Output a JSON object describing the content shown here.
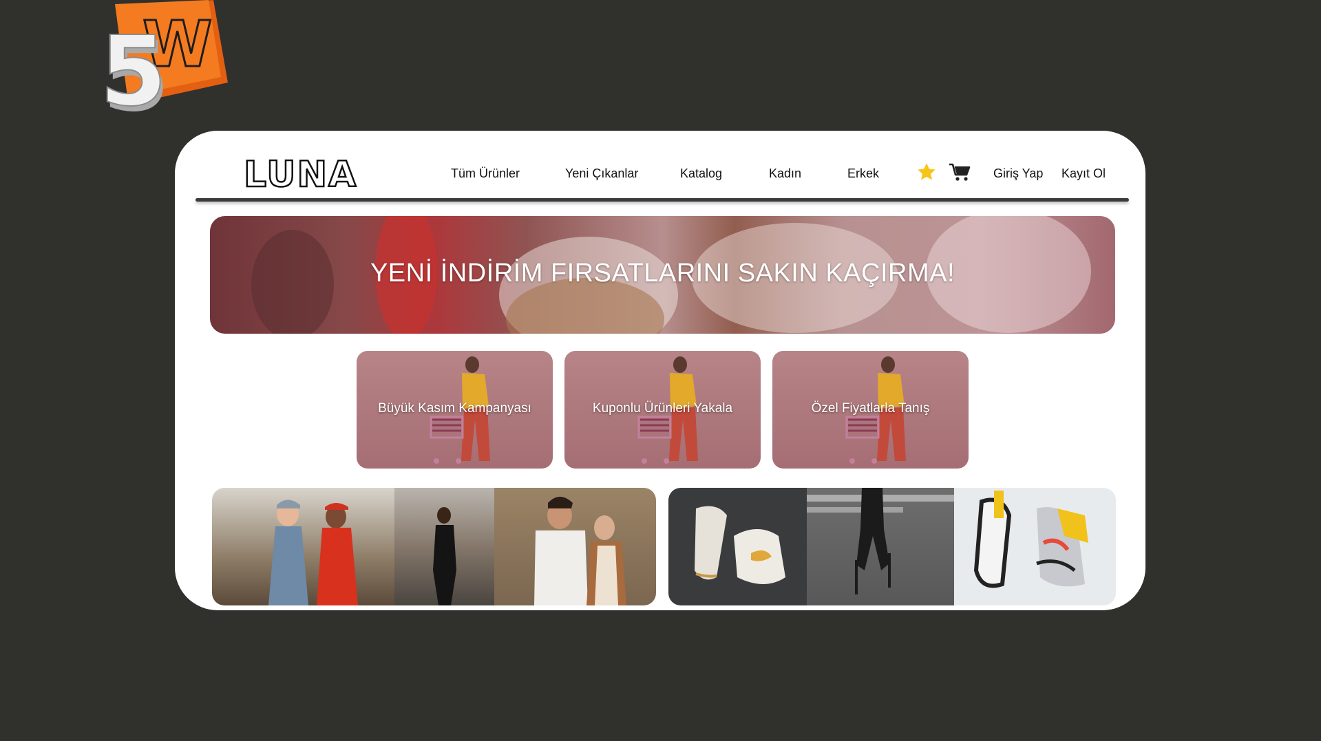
{
  "brand": {
    "name": "LUNA",
    "corner_logo": "5W"
  },
  "nav": {
    "links": [
      "Tüm Ürünler",
      "Yeni Çıkanlar",
      "Katalog",
      "Kadın",
      "Erkek"
    ],
    "favorites_icon": "star-icon",
    "cart_icon": "cart-icon",
    "login": "Giriş Yap",
    "register": "Kayıt Ol"
  },
  "hero": {
    "title": "YENİ İNDİRİM FIRSATLARINI SAKIN KAÇIRMA!"
  },
  "promos": [
    {
      "label": "Büyük Kasım Kampanyası"
    },
    {
      "label": "Kuponlu Ürünleri Yakala"
    },
    {
      "label": "Özel Fiyatlarla Tanış"
    }
  ],
  "colors": {
    "page_bg": "#30302d",
    "accent_orange": "#f07a1a",
    "star": "#f5c518",
    "promo_tint": "#a56e74"
  }
}
